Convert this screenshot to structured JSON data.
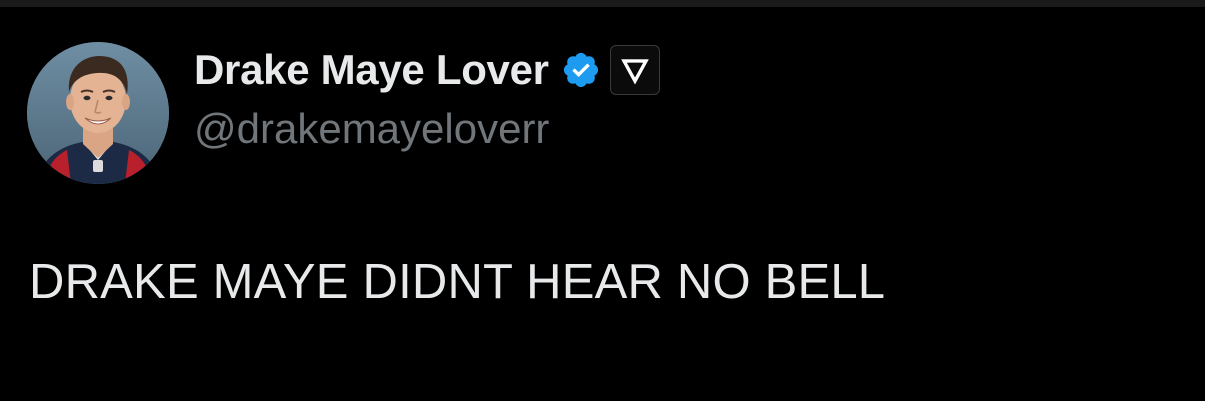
{
  "tweet": {
    "author": {
      "display_name": "Drake Maye Lover",
      "handle": "@drakemayeloverr",
      "verified_color": "#1d9bf0",
      "affiliation_icon": "affiliate-badge-icon"
    },
    "text": "DRAKE MAYE DIDNT HEAR NO BELL"
  },
  "colors": {
    "background": "#000000",
    "primary_text": "#e7e9ea",
    "secondary_text": "#71767b",
    "accent": "#1d9bf0"
  }
}
